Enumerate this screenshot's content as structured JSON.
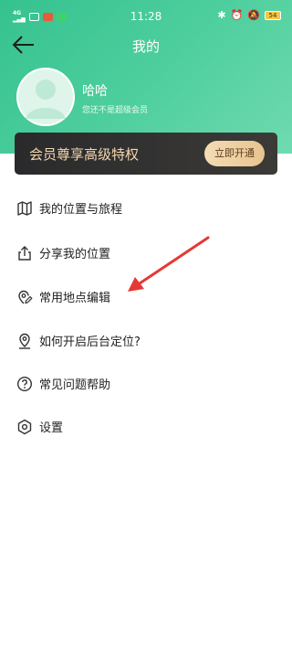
{
  "status_bar": {
    "time": "11:28",
    "battery": "54"
  },
  "header": {
    "title": "我的"
  },
  "profile": {
    "name": "哈哈",
    "member_status": "您还不是超级会员"
  },
  "vip_banner": {
    "text": "会员尊享高级特权",
    "button_label": "立即开通"
  },
  "menu": {
    "items": [
      {
        "label": "我的位置与旅程",
        "icon": "map-icon"
      },
      {
        "label": "分享我的位置",
        "icon": "share-icon"
      },
      {
        "label": "常用地点编辑",
        "icon": "edit-location-icon"
      },
      {
        "label": "如何开启后台定位?",
        "icon": "location-pin-icon"
      },
      {
        "label": "常见问题帮助",
        "icon": "help-icon"
      },
      {
        "label": "设置",
        "icon": "settings-icon"
      }
    ]
  },
  "colors": {
    "header_green": "#45c999",
    "banner_dark": "#2f2f30",
    "banner_gold_text": "#f3d7ad",
    "annotation_red": "#e53935"
  }
}
